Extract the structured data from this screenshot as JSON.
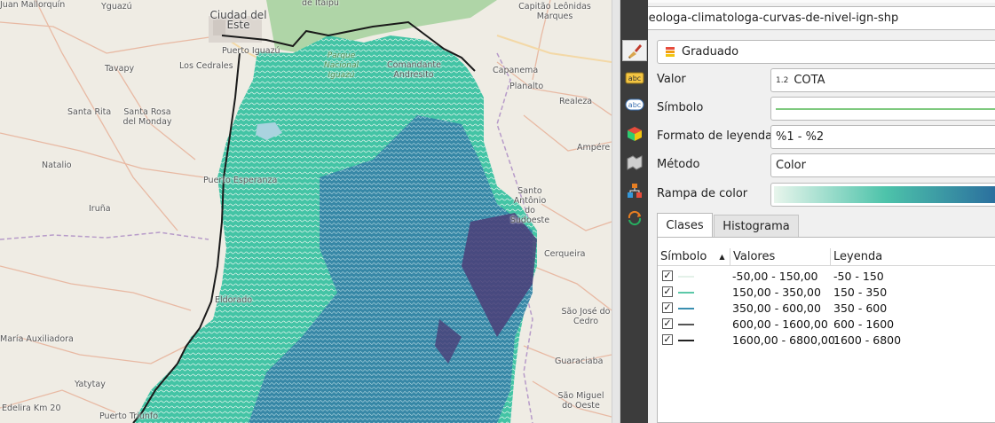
{
  "map": {
    "places": [
      {
        "name": "Juan Mallorquin",
        "label": "Juan Mallorquín"
      },
      {
        "name": "Yguazu",
        "label": "Yguazú"
      },
      {
        "name": "Ciudad del Este",
        "label": "Ciudad del Este",
        "big": true
      },
      {
        "name": "Hernandarias",
        "label": "Hernandarias"
      },
      {
        "name": "Capitao Leonidas Marques",
        "label": "Capitão Leônidas Marques"
      },
      {
        "name": "Tavapy",
        "label": "Tavapy"
      },
      {
        "name": "Los Cedrales",
        "label": "Los Cedrales"
      },
      {
        "name": "Puerto Iguazu",
        "label": "Puerto Iguazú"
      },
      {
        "name": "Parque Nacional",
        "label": "Parque Nacional Iguazú",
        "green": true
      },
      {
        "name": "Comandante Andresito",
        "label": "Comandante Andresito"
      },
      {
        "name": "Capanema",
        "label": "Capanema"
      },
      {
        "name": "Planalto",
        "label": "Planalto"
      },
      {
        "name": "Santa Rita",
        "label": "Santa Rita"
      },
      {
        "name": "Santa Rosa del Monday",
        "label": "Santa Rosa del Monday"
      },
      {
        "name": "Realeza",
        "label": "Realeza"
      },
      {
        "name": "Ampere",
        "label": "Ampére"
      },
      {
        "name": "Natalio",
        "label": "Natalio"
      },
      {
        "name": "Puerto Esperanza",
        "label": "Puerto Esperanza"
      },
      {
        "name": "Santo Antonio do Sudoeste",
        "label": "Santo Antônio do Sudoeste"
      },
      {
        "name": "Iruna",
        "label": "Iruña"
      },
      {
        "name": "Cerqueira",
        "label": "Cerqueira"
      },
      {
        "name": "Eldorado",
        "label": "Eldorado"
      },
      {
        "name": "Sao Jose do Cedro",
        "label": "São José do Cedro"
      },
      {
        "name": "Maria Auxiliadora",
        "label": "María Auxiliadora"
      },
      {
        "name": "Guaraciaba",
        "label": "Guaraciaba"
      },
      {
        "name": "Yatytay",
        "label": "Yatytay"
      },
      {
        "name": "Sao Miguel do Oeste",
        "label": "São Miguel do Oeste"
      },
      {
        "name": "Edelira Km 20",
        "label": "Edelira Km 20"
      },
      {
        "name": "Puerto Triunfo",
        "label": "Puerto Triunfo"
      },
      {
        "name": "Itaipu",
        "label": "de Itaipu"
      }
    ]
  },
  "layer": {
    "name": "geologa-climatologa-curvas-de-nivel-ign-shp"
  },
  "renderer": {
    "type": "Graduado"
  },
  "form": {
    "valor_label": "Valor",
    "valor_prefix": "1.2",
    "valor": "COTA",
    "simbolo_label": "Símbolo",
    "formato_label": "Formato de leyenda",
    "formato": "%1 - %2",
    "metodo_label": "Método",
    "metodo": "Color",
    "rampa_label": "Rampa de color"
  },
  "tabs": [
    {
      "label": "Clases"
    },
    {
      "label": "Histograma"
    }
  ],
  "table": {
    "headers": {
      "symbol": "Símbolo",
      "values": "Valores",
      "legend": "Leyenda"
    },
    "rows": [
      {
        "values": "-50,00 - 150,00",
        "legend": "-50 - 150",
        "color": "#e4f1e9",
        "checked": "✓"
      },
      {
        "values": "150,00 - 350,00",
        "legend": "150 - 350",
        "color": "#5cc8a8",
        "checked": "✓"
      },
      {
        "values": "350,00 - 600,00",
        "legend": "350 - 600",
        "color": "#3a8fb0",
        "checked": "✓"
      },
      {
        "values": "600,00 - 1600,00",
        "legend": "600 - 1600",
        "color": "#555",
        "checked": "✓"
      },
      {
        "values": "1600,00 - 6800,00",
        "legend": "1600 - 6800",
        "color": "#222",
        "checked": "✓"
      }
    ]
  },
  "colors": {
    "ramp_start": "#e8f5ec",
    "ramp_mid": "#4dc3aa",
    "ramp_end": "#2a6e9e"
  }
}
